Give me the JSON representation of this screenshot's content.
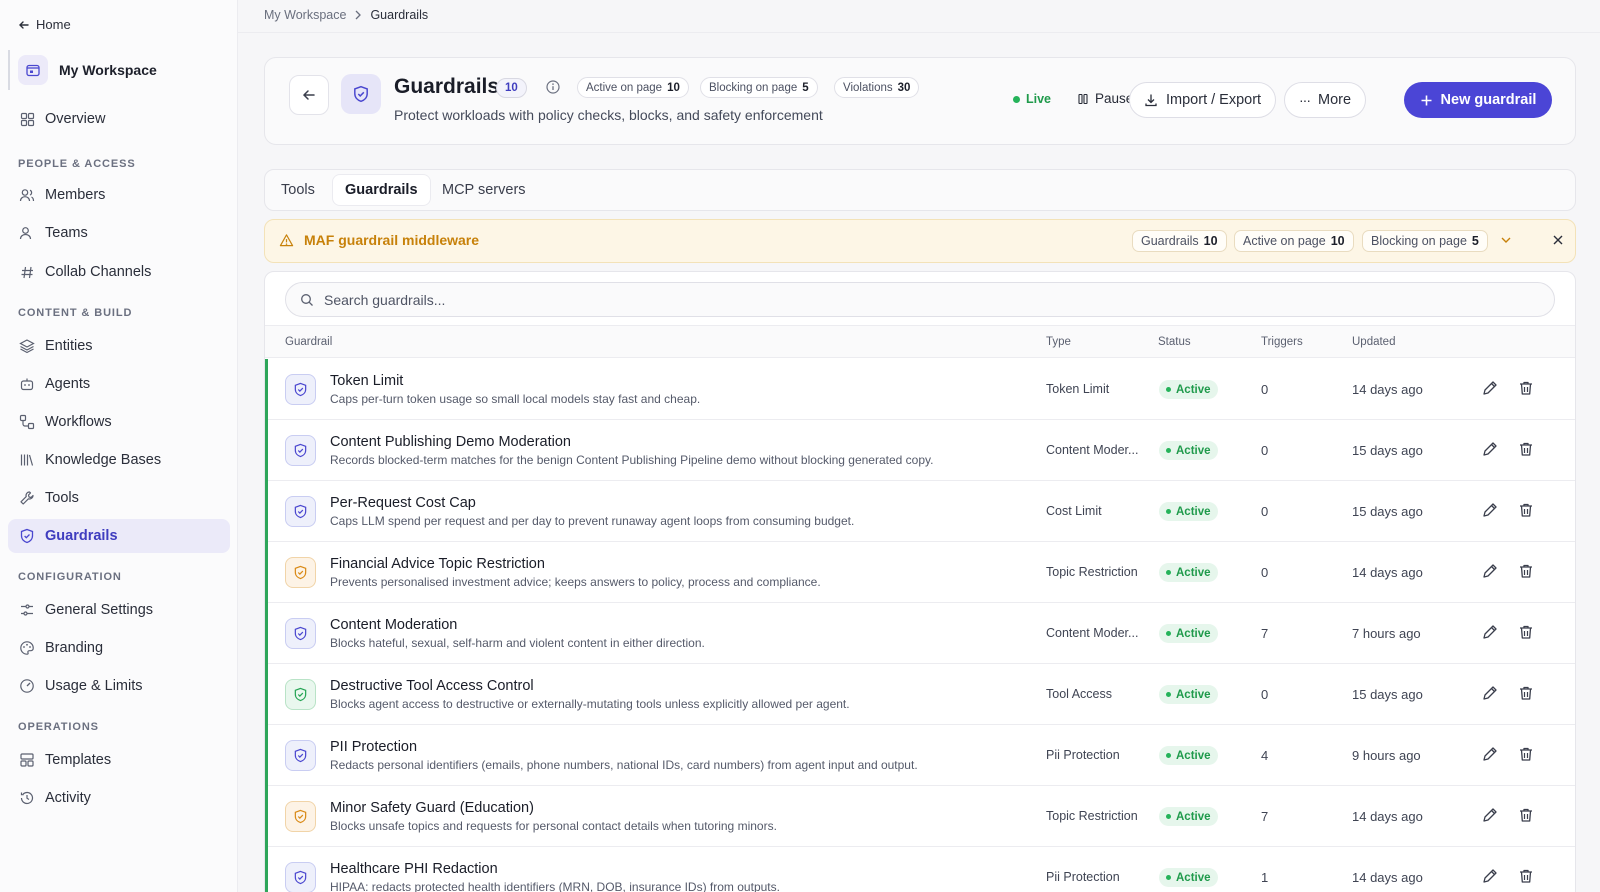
{
  "sidebar": {
    "home_label": "Home",
    "workspace_name": "My Workspace",
    "overview": "Overview",
    "sections": {
      "people": "PEOPLE & ACCESS",
      "content": "CONTENT & BUILD",
      "configuration": "CONFIGURATION",
      "operations": "OPERATIONS"
    },
    "items": {
      "members": "Members",
      "teams": "Teams",
      "collab": "Collab Channels",
      "entities": "Entities",
      "agents": "Agents",
      "workflows": "Workflows",
      "knowledge": "Knowledge Bases",
      "tools": "Tools",
      "guardrails": "Guardrails",
      "general": "General Settings",
      "branding": "Branding",
      "usage": "Usage & Limits",
      "templates": "Templates",
      "activity": "Activity"
    }
  },
  "breadcrumb": {
    "root": "My Workspace",
    "current": "Guardrails"
  },
  "header": {
    "title": "Guardrails",
    "count": "10",
    "stats": [
      {
        "label": "Active on page",
        "value": "10"
      },
      {
        "label": "Blocking on page",
        "value": "5"
      },
      {
        "label": "Violations",
        "value": "30"
      }
    ],
    "subtitle": "Protect workloads with policy checks, blocks, and safety enforcement",
    "live_label": "Live",
    "pause_label": "Pause",
    "import_export_label": "Import / Export",
    "more_label": "More",
    "new_label": "New guardrail"
  },
  "tabs": [
    "Tools",
    "Guardrails",
    "MCP servers"
  ],
  "banner": {
    "title": "MAF guardrail middleware",
    "pills": [
      {
        "label": "Guardrails",
        "value": "10"
      },
      {
        "label": "Active on page",
        "value": "10"
      },
      {
        "label": "Blocking on page",
        "value": "5"
      }
    ]
  },
  "search": {
    "placeholder": "Search guardrails..."
  },
  "table": {
    "columns": [
      "Guardrail",
      "Type",
      "Status",
      "Triggers",
      "Updated"
    ],
    "rows": [
      {
        "name": "Token Limit",
        "desc": "Caps per-turn token usage so small local models stay fast and cheap.",
        "type": "Token Limit",
        "status": "Active",
        "triggers": "0",
        "updated": "14 days ago",
        "tone": "blue"
      },
      {
        "name": "Content Publishing Demo Moderation",
        "desc": "Records blocked-term matches for the benign Content Publishing Pipeline demo without blocking generated copy.",
        "type": "Content Moder...",
        "status": "Active",
        "triggers": "0",
        "updated": "15 days ago",
        "tone": "blue"
      },
      {
        "name": "Per-Request Cost Cap",
        "desc": "Caps LLM spend per request and per day to prevent runaway agent loops from consuming budget.",
        "type": "Cost Limit",
        "status": "Active",
        "triggers": "0",
        "updated": "15 days ago",
        "tone": "blue"
      },
      {
        "name": "Financial Advice Topic Restriction",
        "desc": "Prevents personalised investment advice; keeps answers to policy, process and compliance.",
        "type": "Topic Restriction",
        "status": "Active",
        "triggers": "0",
        "updated": "14 days ago",
        "tone": "orange"
      },
      {
        "name": "Content Moderation",
        "desc": "Blocks hateful, sexual, self-harm and violent content in either direction.",
        "type": "Content Moder...",
        "status": "Active",
        "triggers": "7",
        "updated": "7 hours ago",
        "tone": "blue"
      },
      {
        "name": "Destructive Tool Access Control",
        "desc": "Blocks agent access to destructive or externally-mutating tools unless explicitly allowed per agent.",
        "type": "Tool Access",
        "status": "Active",
        "triggers": "0",
        "updated": "15 days ago",
        "tone": "green"
      },
      {
        "name": "PII Protection",
        "desc": "Redacts personal identifiers (emails, phone numbers, national IDs, card numbers) from agent input and output.",
        "type": "Pii Protection",
        "status": "Active",
        "triggers": "4",
        "updated": "9 hours ago",
        "tone": "blue"
      },
      {
        "name": "Minor Safety Guard (Education)",
        "desc": "Blocks unsafe topics and requests for personal contact details when tutoring minors.",
        "type": "Topic Restriction",
        "status": "Active",
        "triggers": "7",
        "updated": "14 days ago",
        "tone": "orange"
      },
      {
        "name": "Healthcare PHI Redaction",
        "desc": "HIPAA: redacts protected health identifiers (MRN, DOB, insurance IDs) from outputs.",
        "type": "Pii Protection",
        "status": "Active",
        "triggers": "1",
        "updated": "14 days ago",
        "tone": "blue"
      }
    ]
  },
  "colors": {
    "accent": "#4b45d6",
    "active_green": "#1f9a4b",
    "warning": "#c7810a"
  }
}
